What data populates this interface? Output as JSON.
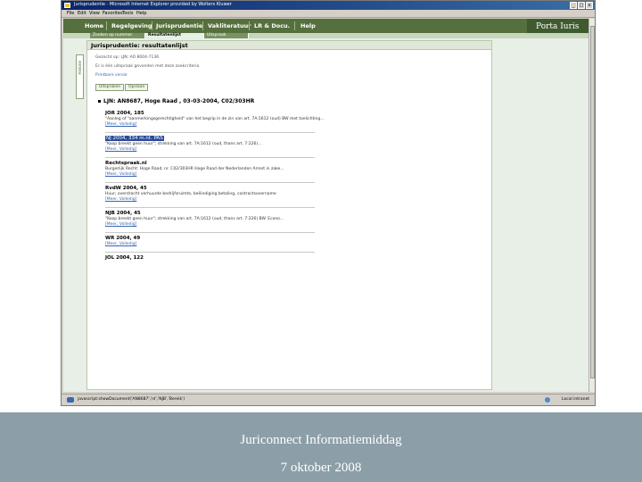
{
  "window": {
    "title": "Jurisprudentie - Microsoft Internet Explorer provided by Wolters Kluwer",
    "controls": [
      "_",
      "□",
      "x"
    ]
  },
  "menu": [
    "File",
    "Edit",
    "View",
    "Favorites",
    "Tools",
    "Help"
  ],
  "nav": {
    "items": [
      "Home",
      "Regelgeving",
      "Jurisprudentie",
      "Vakliteratuur",
      "LR & Docu.",
      "Help"
    ],
    "brand": "Porta Iuris"
  },
  "subtabs": [
    "Zoeken op nummer",
    "Resultatenlijst",
    "Uitspraak"
  ],
  "side_tab": "Historie",
  "panel": {
    "heading": "Jurisprudentie: resultatenlijst",
    "meta": [
      "Gezocht op: LJN: AO 8004-7136",
      "Er is één uitspraak gevonden met deze zoekcriteria",
      "Printbare versie"
    ],
    "buttons": [
      "Uitspraken",
      "Opslaan"
    ]
  },
  "result": {
    "title": "LJN: AN8687, Hoge Raad , 03-03-2004, C02/303HR",
    "sources": [
      {
        "name": "JOR 2004, 185",
        "desc": "\"Aanleg of \"aanmerkingsgerechtigheid\" van het begrip in de zin van art. 7A:1612 (oud) BW met toelichting...",
        "link": "[Meer, Volledig]",
        "selected": false
      },
      {
        "name": "NJ 2004, 334 m.nt. PAS",
        "desc": "\"Koop breekt geen huur\"; strekking van art. 7A:1612 (oud, thans art. 7:226)...",
        "link": "[Meer, Volledig]",
        "selected": true
      },
      {
        "name": "Rechtspraak.nl",
        "desc": "Burgerlijk Recht: Hoge Raad, nr. C02/303HR Hoge Raad der Nederlanden Arrest in zake...",
        "link": "[Meer, Volledig]",
        "selected": false
      },
      {
        "name": "RvdW 2004, 45",
        "desc": "Huur; overdracht verhuurde bedrijfsruimte, beëindiging betaling, contractsovername",
        "link": "[Meer, Volledig]",
        "selected": false
      },
      {
        "name": "NJB 2004, 45",
        "desc": "\"Koop breekt geen huur\"; strekking van art. 7A:1612 (oud, thans art. 7:226) BW. Econo...",
        "link": "[Meer, Volledig]",
        "selected": false
      },
      {
        "name": "WR 2004, 49",
        "desc": "",
        "link": "[Meer, Volledig]",
        "selected": false
      },
      {
        "name": "JOL 2004, 122",
        "desc": "",
        "link": "",
        "selected": false
      }
    ]
  },
  "statusbar": {
    "text": "javascript:showDocument('AN8687','nl','NJB','Bereik')",
    "zone": "Local intranet"
  },
  "footer": {
    "line1": "Juriconnect Informatiemiddag",
    "line2": "7 oktober 2008"
  },
  "colors": {
    "nav_bg": "#56703d",
    "brand_bg": "#3f5b2e",
    "page_bg": "#e8efe6",
    "selection": "#2a4a9a",
    "link": "#3b66b0",
    "footer_bg": "#8c9ea8"
  }
}
